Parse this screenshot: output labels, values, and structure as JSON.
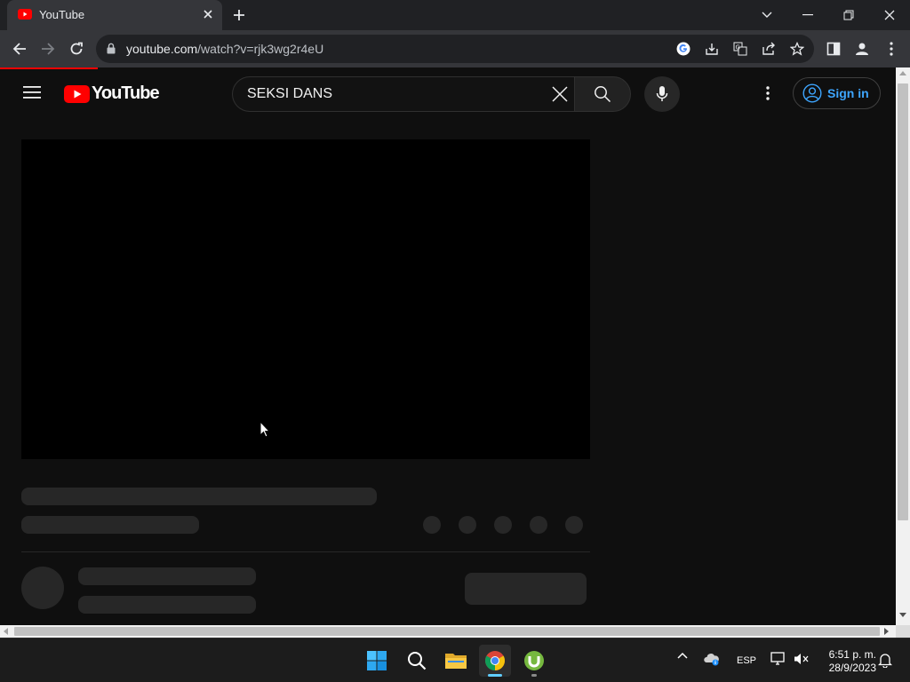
{
  "browser": {
    "tab": {
      "title": "YouTube",
      "favicon": "youtube-favicon"
    },
    "address": {
      "host": "youtube.com",
      "path": "/watch?v=rjk3wg2r4eU"
    }
  },
  "youtube": {
    "logo_text": "YouTube",
    "search": {
      "query": "SEKSI DANS"
    },
    "signin_label": "Sign in"
  },
  "taskbar": {
    "apps": [
      "windows-start",
      "search",
      "file-explorer",
      "google-chrome",
      "utorrent"
    ],
    "tray": {
      "language": "ESP",
      "time": "6:51 p. m.",
      "date": "28/9/2023"
    }
  },
  "colors": {
    "youtube_red": "#ff0000",
    "link_blue": "#3ea6ff",
    "page_bg": "#0f0f0f",
    "skeleton": "#272727"
  }
}
